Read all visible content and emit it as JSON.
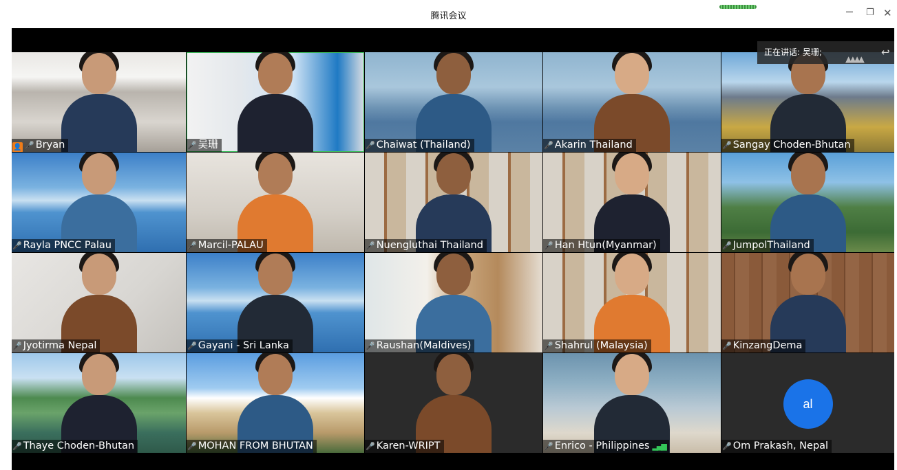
{
  "window": {
    "title": "腾讯会议",
    "min_icon": "minimize-icon",
    "max_icon": "restore-icon",
    "close_icon": "close-icon"
  },
  "speaking": {
    "text": "正在讲话: 吴珊;"
  },
  "participants": [
    {
      "name": "Bryan",
      "host": true,
      "background": "classroom"
    },
    {
      "name": "吴珊",
      "background": "banner"
    },
    {
      "name": "Chaiwat  (Thailand)",
      "background": "mountain"
    },
    {
      "name": "Akarin Thailand",
      "background": "mountain"
    },
    {
      "name": "Sangay Choden-Bhutan",
      "background": "valley"
    },
    {
      "name": "Rayla PNCC Palau",
      "background": "ocean"
    },
    {
      "name": "Marcil-PALAU",
      "background": "room"
    },
    {
      "name": "Nuengluthai Thailand",
      "background": "shelves"
    },
    {
      "name": "Han Htun(Myanmar)",
      "background": "shelves"
    },
    {
      "name": "JumpolThailand",
      "background": "karst"
    },
    {
      "name": "Jyotirma Nepal",
      "background": "wall"
    },
    {
      "name": "Gayani - Sri Lanka",
      "background": "ocean"
    },
    {
      "name": "Raushan(Maldives)",
      "background": "office"
    },
    {
      "name": "Shahrul (Malaysia)",
      "background": "shelves"
    },
    {
      "name": "KinzangDema",
      "background": "wood"
    },
    {
      "name": "Thaye Choden-Bhutan",
      "background": "bhutan"
    },
    {
      "name": "MOHAN FROM BHUTAN",
      "background": "dzong"
    },
    {
      "name": "Karen-WRIPT",
      "background": "plain"
    },
    {
      "name": "Enrico - Philippines",
      "background": "map",
      "signal_icon": true
    },
    {
      "name": "Om Prakash, Nepal",
      "background": "plain",
      "avatar": "al"
    }
  ]
}
